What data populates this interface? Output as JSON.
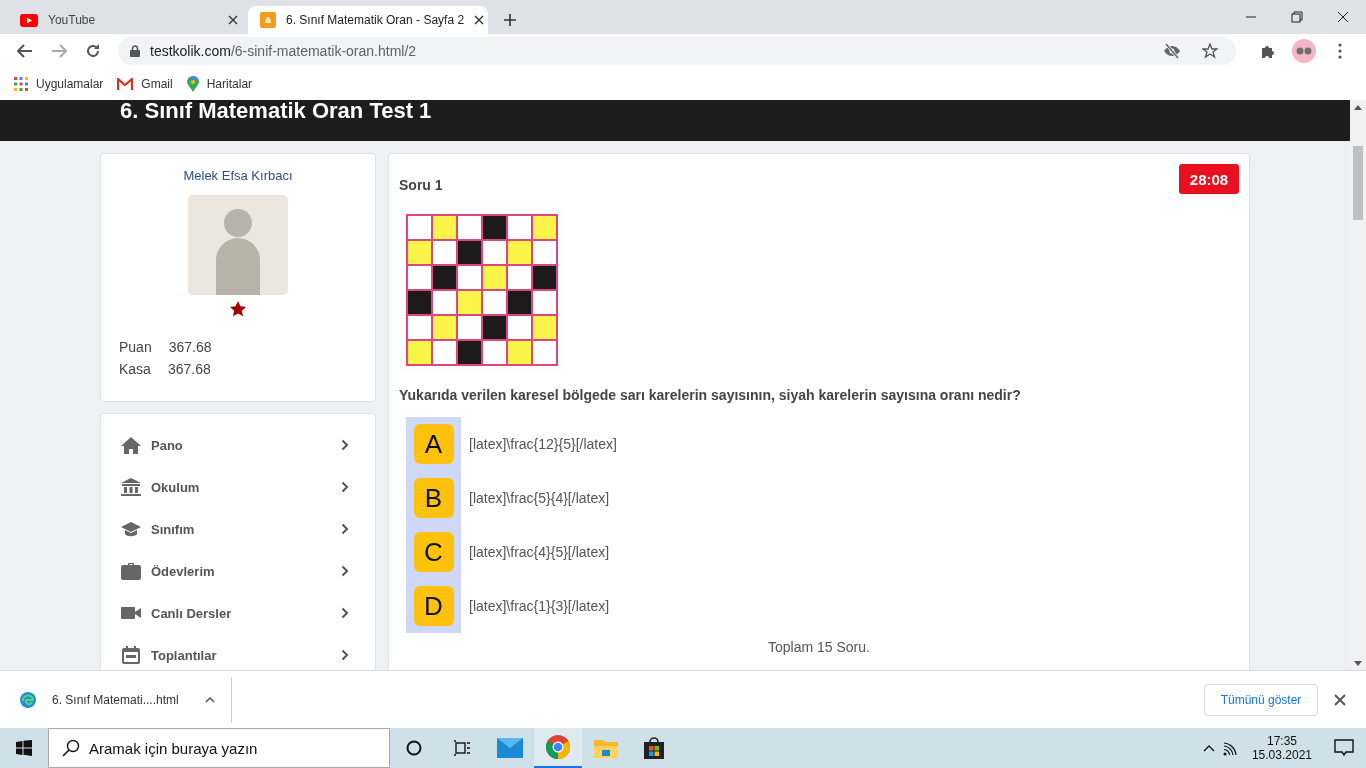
{
  "browser": {
    "tabs": [
      {
        "title": "YouTube",
        "selected": false
      },
      {
        "title": "6. Sınıf Matematik Oran - Sayfa 2",
        "selected": true
      }
    ],
    "url": {
      "host": "testkolik.com",
      "path": "/6-sinif-matematik-oran.html/2"
    },
    "bookmarks": [
      "Uygulamalar",
      "Gmail",
      "Haritalar"
    ]
  },
  "page": {
    "title": "6. Sınıf Matematik Oran Test 1",
    "profile": {
      "name": "Melek Efsa Kırbacı",
      "stats": [
        {
          "label": "Puan",
          "value": "367.68"
        },
        {
          "label": "Kasa",
          "value": "367.68"
        }
      ]
    },
    "menu": [
      "Pano",
      "Okulum",
      "Sınıfım",
      "Ödevlerim",
      "Canlı Dersler",
      "Toplantılar"
    ],
    "question": {
      "label": "Soru 1",
      "timer": "28:08",
      "figure": {
        "rows": [
          [
            {
              "color": "#ffffff"
            },
            {
              "color": "#fbf54a"
            },
            {
              "color": "#ffffff"
            },
            {
              "color": "#1c1a1a"
            },
            {
              "color": "#ffffff"
            },
            {
              "color": "#fbf54a"
            }
          ],
          [
            {
              "color": "#fbf54a"
            },
            {
              "color": "#ffffff"
            },
            {
              "color": "#1c1a1a"
            },
            {
              "color": "#ffffff"
            },
            {
              "color": "#fbf54a"
            },
            {
              "color": "#ffffff"
            }
          ],
          [
            {
              "color": "#ffffff"
            },
            {
              "color": "#1c1a1a"
            },
            {
              "color": "#ffffff"
            },
            {
              "color": "#fbf54a"
            },
            {
              "color": "#ffffff"
            },
            {
              "color": "#1c1a1a"
            }
          ],
          [
            {
              "color": "#1c1a1a"
            },
            {
              "color": "#ffffff"
            },
            {
              "color": "#fbf54a"
            },
            {
              "color": "#ffffff"
            },
            {
              "color": "#1c1a1a"
            },
            {
              "color": "#ffffff"
            }
          ],
          [
            {
              "color": "#ffffff"
            },
            {
              "color": "#fbf54a"
            },
            {
              "color": "#ffffff"
            },
            {
              "color": "#1c1a1a"
            },
            {
              "color": "#ffffff"
            },
            {
              "color": "#fbf54a"
            }
          ],
          [
            {
              "color": "#fbf54a"
            },
            {
              "color": "#ffffff"
            },
            {
              "color": "#1c1a1a"
            },
            {
              "color": "#ffffff"
            },
            {
              "color": "#fbf54a"
            },
            {
              "color": "#ffffff"
            }
          ]
        ]
      },
      "text": "Yukarıda verilen karesel bölgede sarı karelerin sayısının, siyah karelerin sayısına oranı nedir?",
      "options": [
        {
          "letter": "A",
          "text": "[latex]\\frac{12}{5}[/latex]"
        },
        {
          "letter": "B",
          "text": "[latex]\\frac{5}{4}[/latex]"
        },
        {
          "letter": "C",
          "text": "[latex]\\frac{4}{5}[/latex]"
        },
        {
          "letter": "D",
          "text": "[latex]\\frac{1}{3}[/latex]"
        }
      ],
      "total": "Toplam 15 Soru."
    }
  },
  "downloads": {
    "file": "6. Sınıf Matemati....html",
    "show_all": "Tümünü göster"
  },
  "taskbar": {
    "search_placeholder": "Aramak için buraya yazın",
    "apps": [
      {
        "selected": false
      },
      {
        "selected": false
      },
      {
        "selected": false
      },
      {
        "selected": true
      },
      {
        "selected": false
      },
      {
        "selected": false
      }
    ],
    "time": "17:35",
    "date": "15.03.2021"
  }
}
